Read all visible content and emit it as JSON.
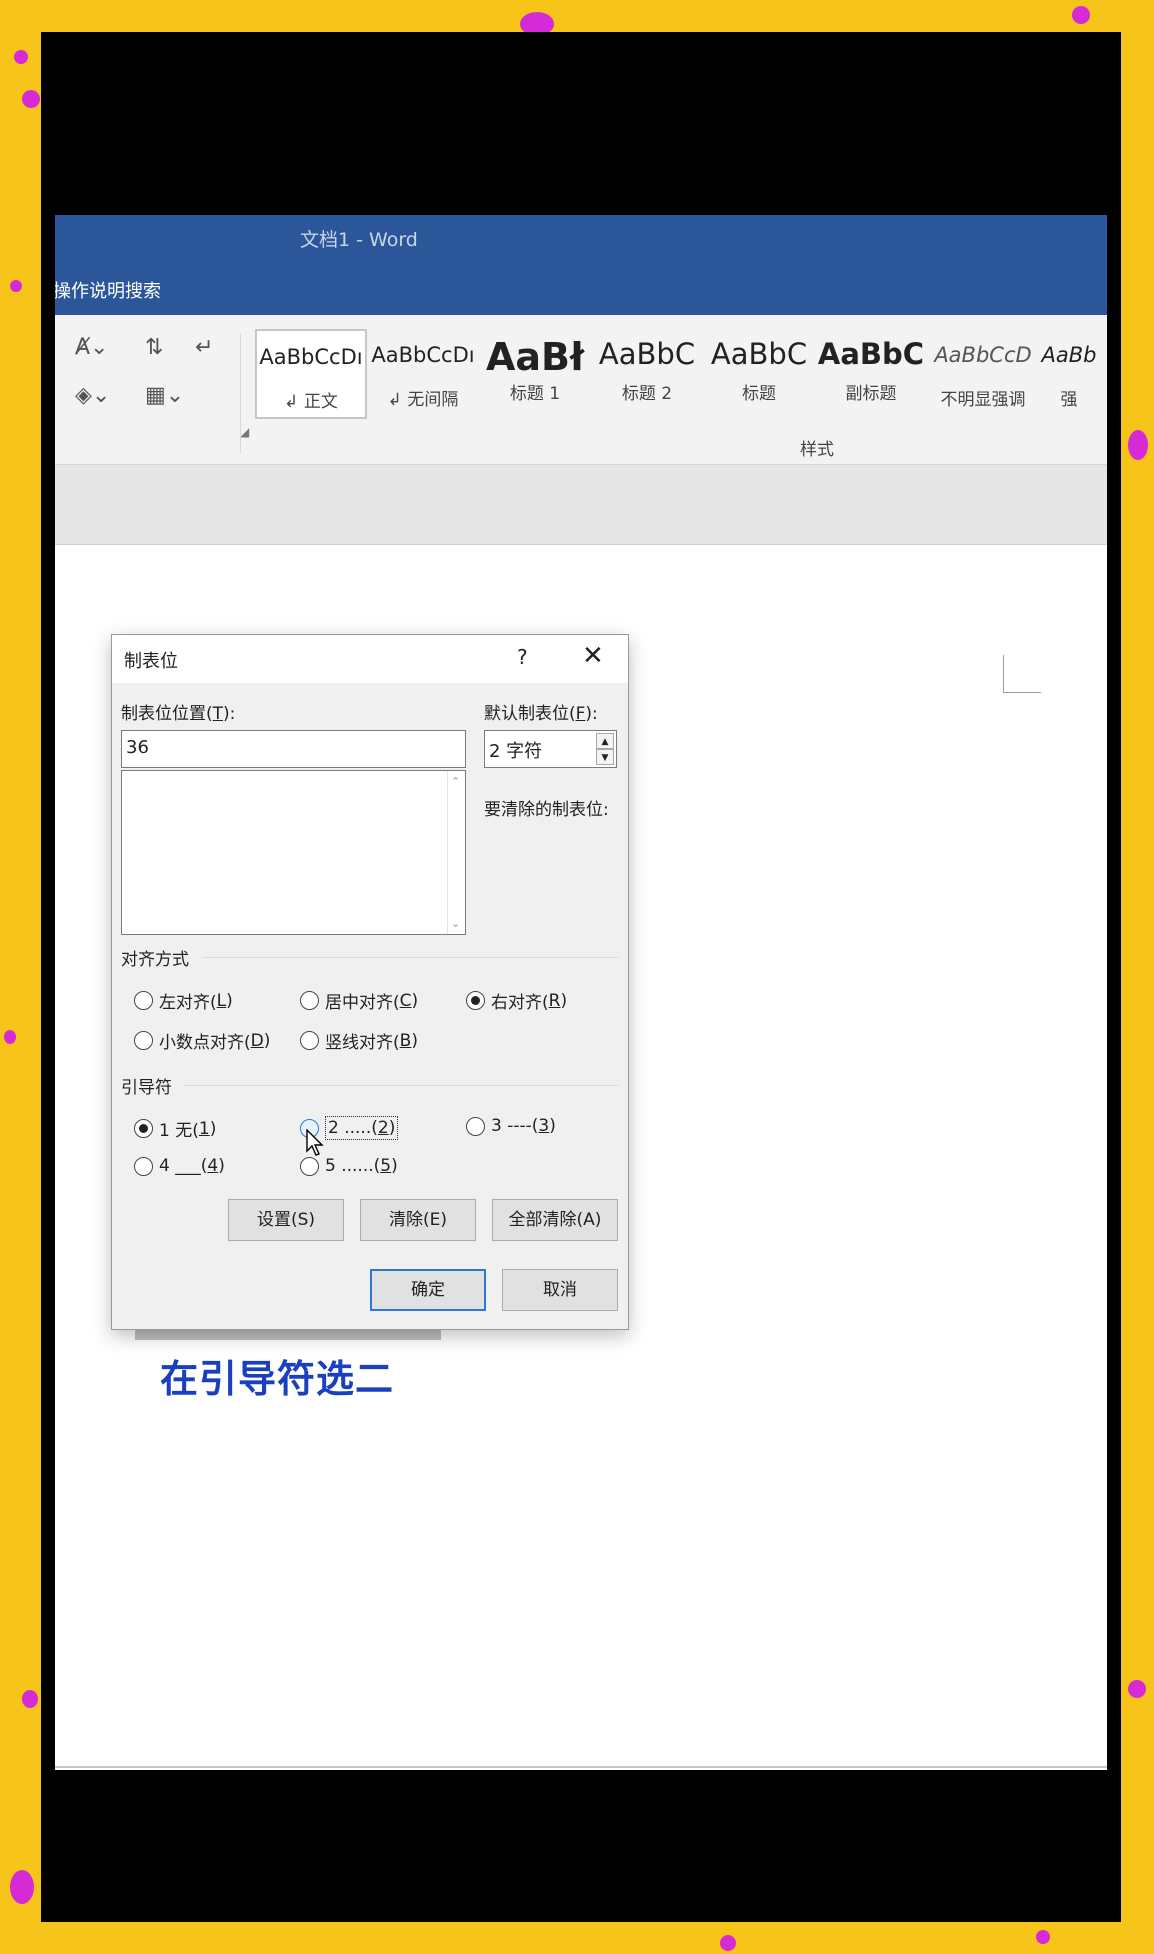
{
  "window": {
    "title": "文档1  -  Word",
    "search_label": "操作说明搜索"
  },
  "ribbon": {
    "styles_group_label": "样式",
    "styles": [
      {
        "preview": "AaBbCcDı",
        "label": "↲ 正文",
        "selected": true
      },
      {
        "preview": "AaBbCcDı",
        "label": "↲ 无间隔",
        "selected": false
      },
      {
        "preview": "AaBł",
        "label": "标题 1",
        "selected": false
      },
      {
        "preview": "AaBbC",
        "label": "标题 2",
        "selected": false
      },
      {
        "preview": "AaBbC",
        "label": "标题",
        "selected": false
      },
      {
        "preview": "AaBbC",
        "label": "副标题",
        "selected": false
      },
      {
        "preview": "AaBbCcD",
        "label": "不明显强调",
        "selected": false
      },
      {
        "preview": "AaBb",
        "label": "强",
        "selected": false
      }
    ]
  },
  "dialog": {
    "title": "制表位",
    "help": "?",
    "close": "✕",
    "tab_position_label": "制表位位置(",
    "tab_position_key": "T",
    "tab_position_value": "36",
    "default_tab_label": "默认制表位(",
    "default_tab_key": "F",
    "default_tab_value": "2 字符",
    "to_clear_label": "要清除的制表位:",
    "alignment_section": "对齐方式",
    "alignment_options": [
      {
        "text": "左对齐(",
        "key": "L",
        "checked": false
      },
      {
        "text": "居中对齐(",
        "key": "C",
        "checked": false
      },
      {
        "text": "右对齐(",
        "key": "R",
        "checked": true
      },
      {
        "text": "小数点对齐(",
        "key": "D",
        "checked": false
      },
      {
        "text": "竖线对齐(",
        "key": "B",
        "checked": false
      }
    ],
    "leader_section": "引导符",
    "leader_options": [
      {
        "text": "1 无(",
        "key": "1",
        "checked": true
      },
      {
        "text": "2 .....(",
        "key": "2",
        "checked": false
      },
      {
        "text": "3 ----(",
        "key": "3",
        "checked": false
      },
      {
        "text": "4 ___(",
        "key": "4",
        "checked": false
      },
      {
        "text": "5 ......(",
        "key": "5",
        "checked": false
      }
    ],
    "buttons": {
      "set": "设置(S)",
      "clear": "清除(E)",
      "clear_all": "全部清除(A)",
      "ok": "确定",
      "cancel": "取消"
    }
  },
  "caption": "在引导符选二"
}
